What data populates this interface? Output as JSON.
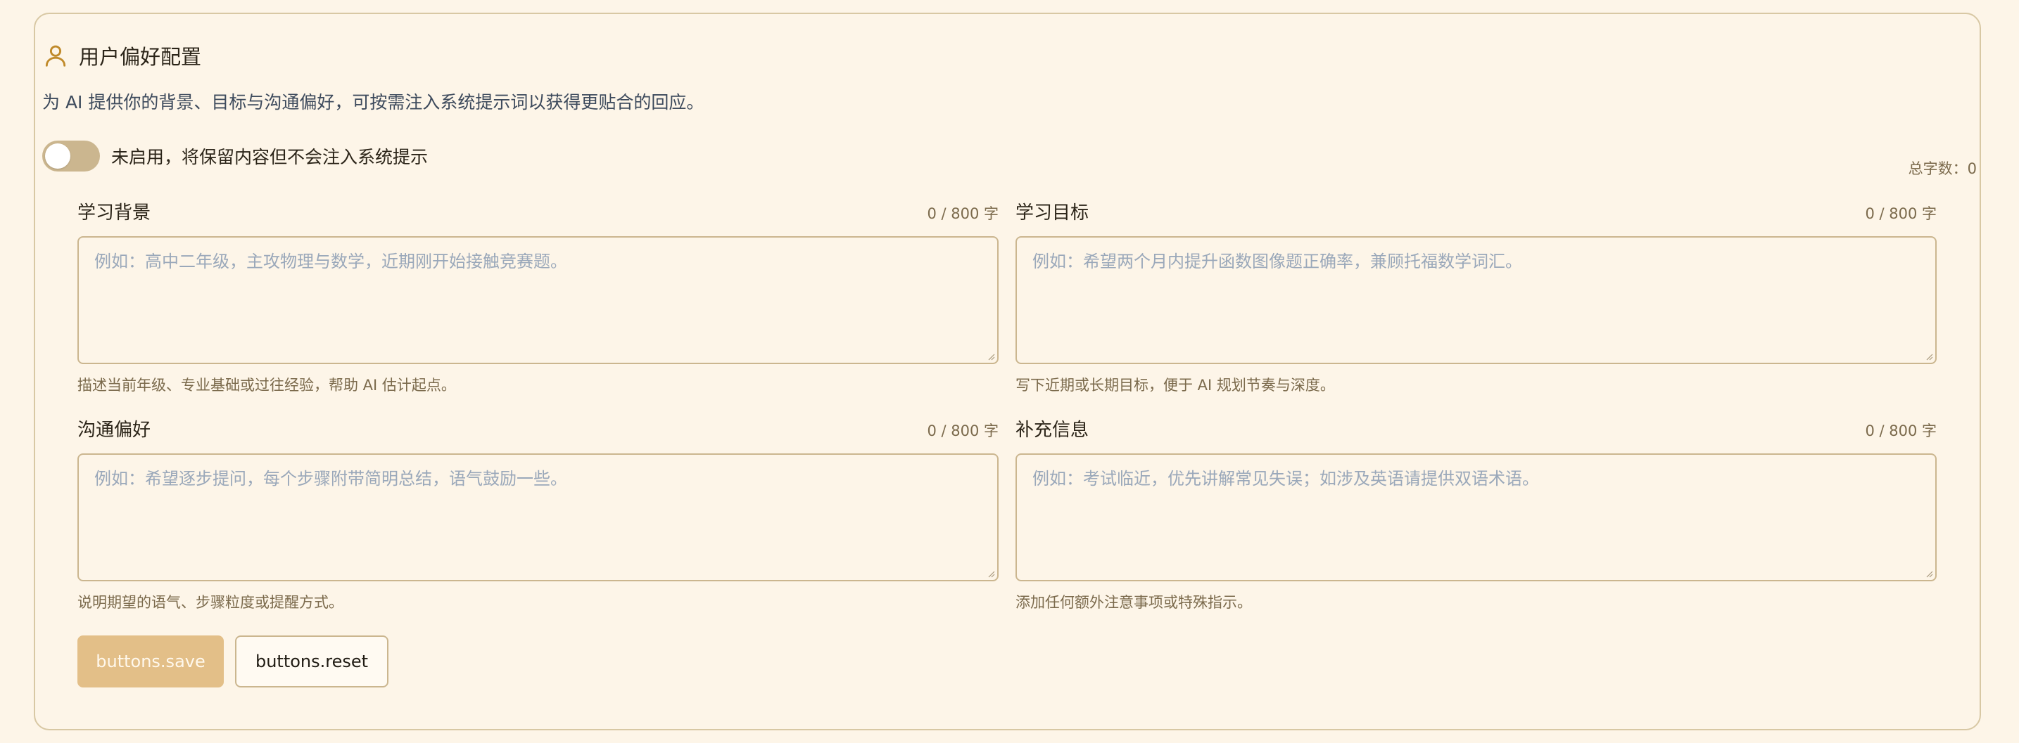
{
  "header": {
    "title": "用户偏好配置",
    "subtitle": "为 AI 提供你的背景、目标与沟通偏好，可按需注入系统提示词以获得更贴合的回应。",
    "icon": "user-icon",
    "icon_color": "#c08a2a"
  },
  "toggle": {
    "enabled": false,
    "label": "未启用，将保留内容但不会注入系统提示"
  },
  "total_count": "总字数：0",
  "fields": [
    {
      "label": "学习背景",
      "count": "0 / 800 字",
      "value": "",
      "placeholder": "例如：高中二年级，主攻物理与数学，近期刚开始接触竞赛题。",
      "hint": "描述当前年级、专业基础或过往经验，帮助 AI 估计起点。"
    },
    {
      "label": "学习目标",
      "count": "0 / 800 字",
      "value": "",
      "placeholder": "例如：希望两个月内提升函数图像题正确率，兼顾托福数学词汇。",
      "hint": "写下近期或长期目标，便于 AI 规划节奏与深度。"
    },
    {
      "label": "沟通偏好",
      "count": "0 / 800 字",
      "value": "",
      "placeholder": "例如：希望逐步提问，每个步骤附带简明总结，语气鼓励一些。",
      "hint": "说明期望的语气、步骤粒度或提醒方式。"
    },
    {
      "label": "补充信息",
      "count": "0 / 800 字",
      "value": "",
      "placeholder": "例如：考试临近，优先讲解常见失误；如涉及英语请提供双语术语。",
      "hint": "添加任何额外注意事项或特殊指示。"
    }
  ],
  "buttons": {
    "save": "buttons.save",
    "reset": "buttons.reset"
  },
  "colors": {
    "background": "#fdf5e8",
    "border": "#cbb68f",
    "save_button": "#e3bf88",
    "toggle_off": "#cbb68f",
    "placeholder": "#9aa8ba"
  }
}
